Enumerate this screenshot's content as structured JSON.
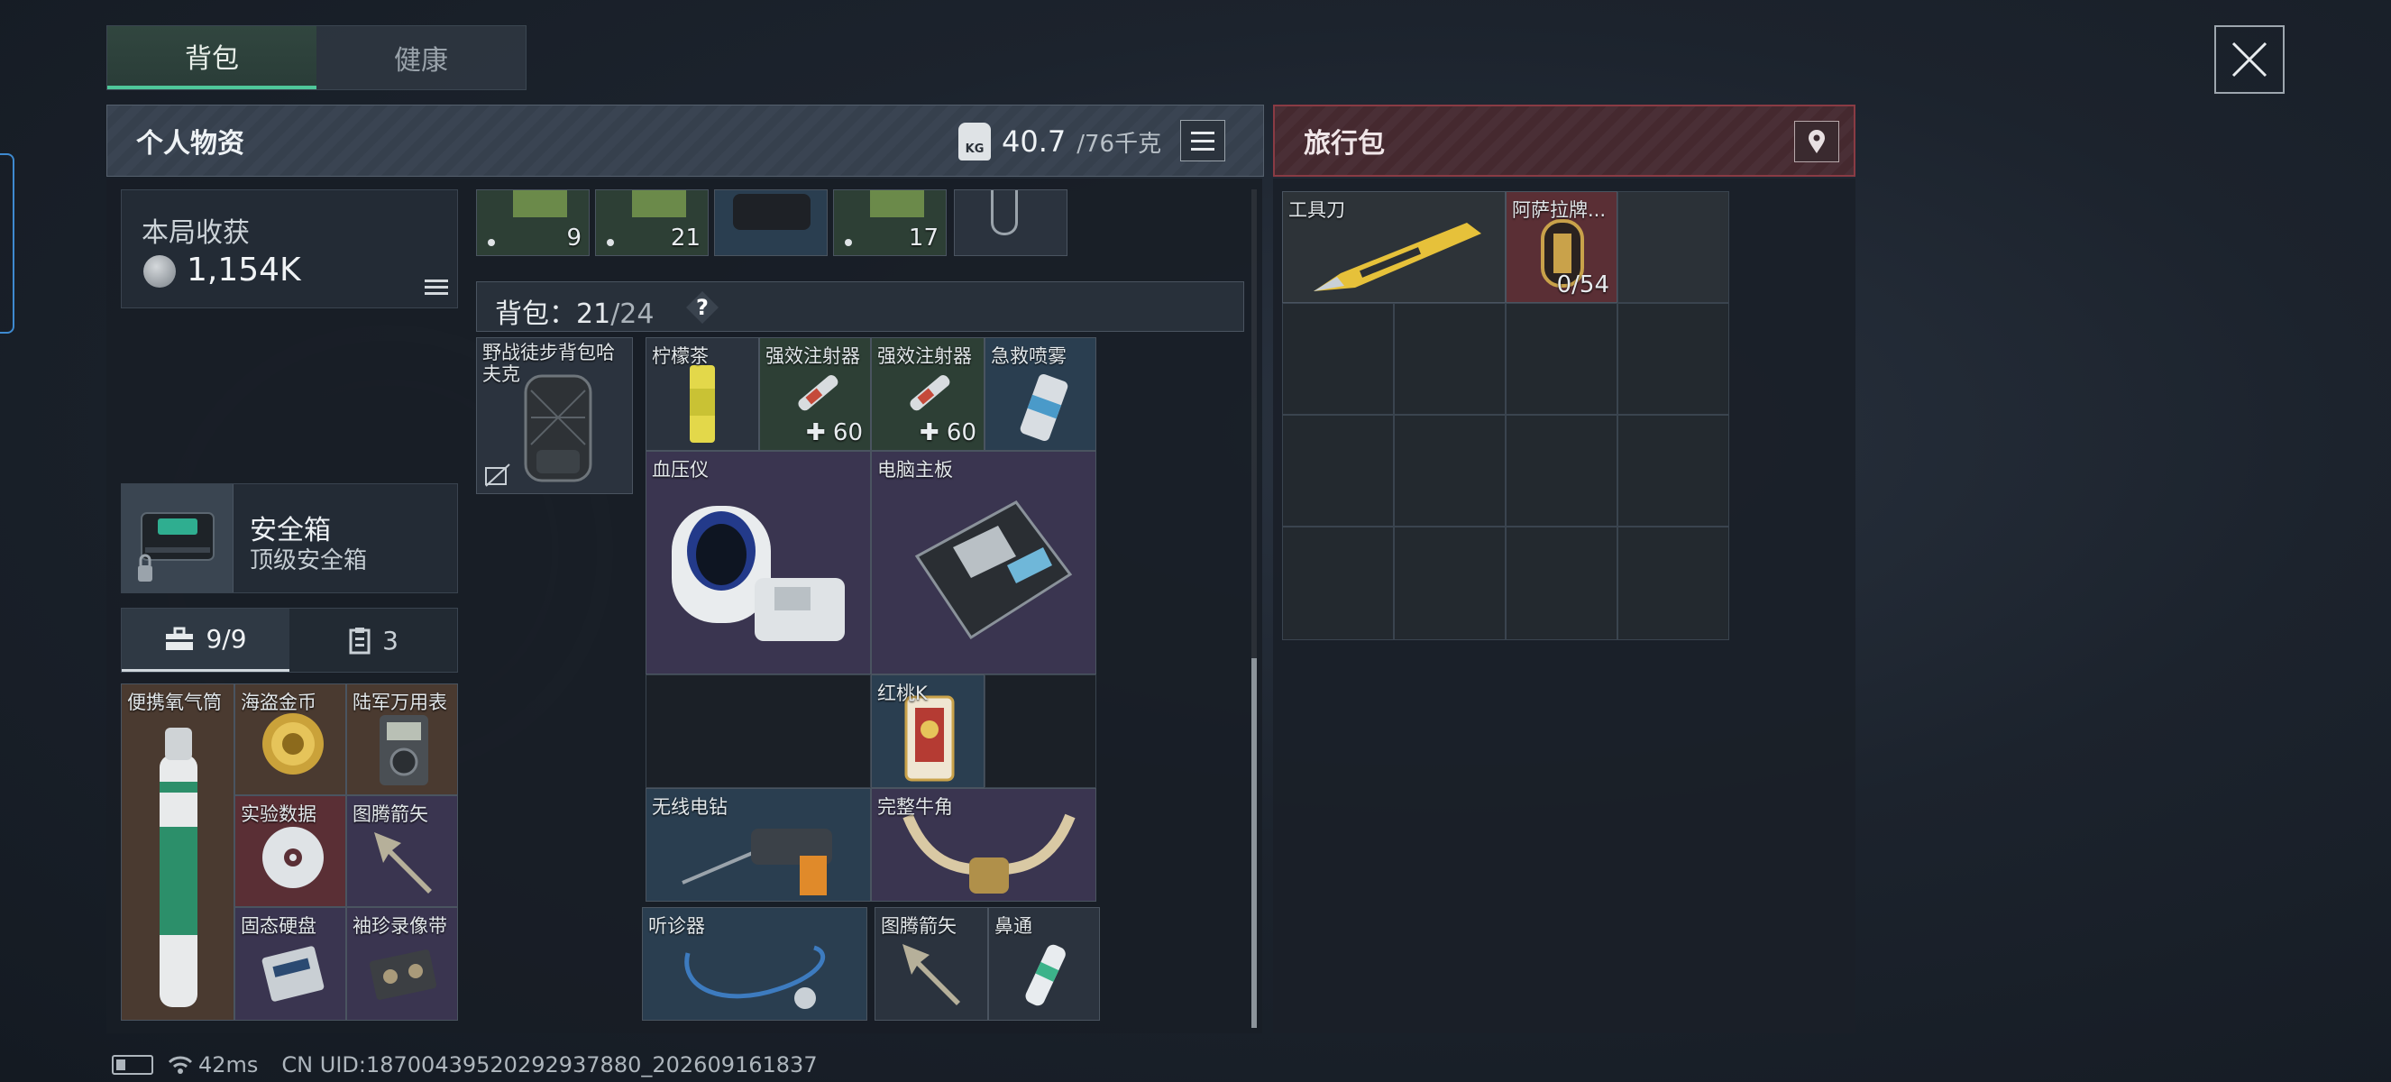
{
  "tabs": [
    {
      "label": "背包"
    },
    {
      "label": "健康"
    }
  ],
  "personal": {
    "title": "个人物资",
    "weight_current": "40.7",
    "weight_max": "/76千克",
    "weight_icon_text": "KG"
  },
  "travel": {
    "title": "旅行包"
  },
  "harvest": {
    "label": "本局收获",
    "value": "1,154K"
  },
  "safe_box": {
    "name": "安全箱",
    "subtitle": "顶级安全箱"
  },
  "sub_tabs": [
    {
      "label": "9/9"
    },
    {
      "label": "3"
    }
  ],
  "top_strip_counts": [
    "9",
    "21",
    "",
    "17",
    ""
  ],
  "bag": {
    "label": "背包：",
    "current": "21",
    "max": "/24",
    "help": "?"
  },
  "backpack_slot": {
    "name": "野战徒步背包哈夫克"
  },
  "left_items": [
    {
      "name": "便携氧气筒"
    },
    {
      "name": "海盗金币"
    },
    {
      "name": "陆军万用表"
    },
    {
      "name": "实验数据"
    },
    {
      "name": "图腾箭矢"
    },
    {
      "name": "固态硬盘"
    },
    {
      "name": "袖珍录像带"
    }
  ],
  "bag_items": [
    {
      "name": "柠檬茶",
      "count": ""
    },
    {
      "name": "强效注射器",
      "count": "60"
    },
    {
      "name": "强效注射器",
      "count": "60"
    },
    {
      "name": "急救喷雾",
      "count": ""
    },
    {
      "name": "血压仪",
      "count": ""
    },
    {
      "name": "电脑主板",
      "count": ""
    },
    {
      "name": "红桃K",
      "count": ""
    },
    {
      "name": "无线电钻",
      "count": ""
    },
    {
      "name": "完整牛角",
      "count": ""
    }
  ],
  "bottom_items": [
    {
      "name": "听诊器"
    },
    {
      "name": "图腾箭矢"
    },
    {
      "name": "鼻通"
    }
  ],
  "travel_items": [
    {
      "name": "工具刀",
      "count": ""
    },
    {
      "name": "阿萨拉牌...",
      "count": "0/54"
    }
  ],
  "status": {
    "ping": "42ms",
    "uid": "CN UID:18700439520292937880_202609161837"
  },
  "colors": {
    "accent_green": "#4fc79a",
    "travel_red": "#8a3b44",
    "rarity_brown": "#4a3a30",
    "rarity_red": "#5a2f35",
    "rarity_purple": "#3a3550",
    "rarity_green": "#2d3f35",
    "rarity_blue": "#2a3e50"
  }
}
